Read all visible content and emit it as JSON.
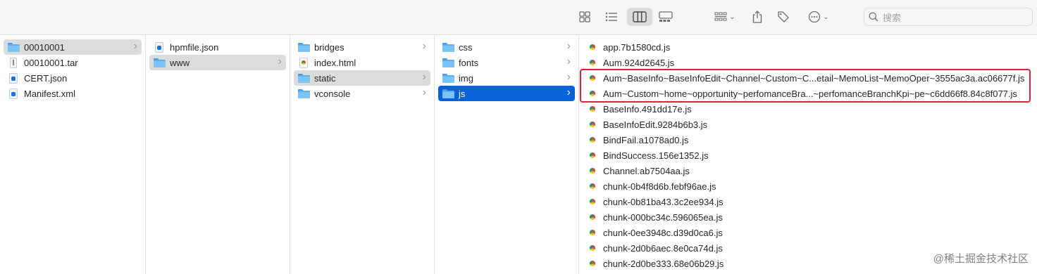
{
  "toolbar": {
    "icons": [
      "grid-view-icon",
      "list-view-icon",
      "column-view-icon",
      "gallery-view-icon",
      "group-icon",
      "share-icon",
      "tag-icon",
      "more-icon"
    ],
    "active_view": "column",
    "search_placeholder": "搜索"
  },
  "columns": [
    {
      "items": [
        {
          "name": "00010001",
          "kind": "folder",
          "state": "selected-gray",
          "has_children": true
        },
        {
          "name": "00010001.tar",
          "kind": "plain-file"
        },
        {
          "name": "CERT.json",
          "kind": "json-file"
        },
        {
          "name": "Manifest.xml",
          "kind": "xml-file"
        }
      ]
    },
    {
      "items": [
        {
          "name": "hpmfile.json",
          "kind": "json-file"
        },
        {
          "name": "www",
          "kind": "folder",
          "state": "selected-gray",
          "has_children": true
        }
      ]
    },
    {
      "items": [
        {
          "name": "bridges",
          "kind": "folder",
          "has_children": true
        },
        {
          "name": "index.html",
          "kind": "html-file"
        },
        {
          "name": "static",
          "kind": "folder",
          "state": "selected-gray",
          "has_children": true
        },
        {
          "name": "vconsole",
          "kind": "folder",
          "has_children": true
        }
      ]
    },
    {
      "items": [
        {
          "name": "css",
          "kind": "folder",
          "has_children": true
        },
        {
          "name": "fonts",
          "kind": "folder",
          "has_children": true
        },
        {
          "name": "img",
          "kind": "folder",
          "has_children": true
        },
        {
          "name": "js",
          "kind": "folder",
          "state": "selected-blue",
          "has_children": true
        }
      ]
    },
    {
      "items": [
        {
          "name": "app.7b1580cd.js",
          "kind": "js-file"
        },
        {
          "name": "Aum.924d2645.js",
          "kind": "js-file"
        },
        {
          "name": "Aum~BaseInfo~BaseInfoEdit~Channel~Custom~C...etail~MemoList~MemoOper~3555ac3a.ac06677f.js",
          "kind": "js-file",
          "highlighted": true
        },
        {
          "name": "Aum~Custom~home~opportunity~perfomanceBra...~perfomanceBranchKpi~pe~c6dd66f8.84c8f077.js",
          "kind": "js-file",
          "highlighted": true
        },
        {
          "name": "BaseInfo.491dd17e.js",
          "kind": "js-file"
        },
        {
          "name": "BaseInfoEdit.9284b6b3.js",
          "kind": "js-file"
        },
        {
          "name": "BindFail.a1078ad0.js",
          "kind": "js-file"
        },
        {
          "name": "BindSuccess.156e1352.js",
          "kind": "js-file"
        },
        {
          "name": "Channel.ab7504aa.js",
          "kind": "js-file"
        },
        {
          "name": "chunk-0b4f8d6b.febf96ae.js",
          "kind": "js-file"
        },
        {
          "name": "chunk-0b81ba43.3c2ee934.js",
          "kind": "js-file"
        },
        {
          "name": "chunk-000bc34c.596065ea.js",
          "kind": "js-file"
        },
        {
          "name": "chunk-0ee3948c.d39d0ca6.js",
          "kind": "js-file"
        },
        {
          "name": "chunk-2d0b6aec.8e0ca74d.js",
          "kind": "js-file"
        },
        {
          "name": "chunk-2d0be333.68e06b29.js",
          "kind": "js-file"
        }
      ]
    }
  ],
  "highlight_color": "#e0213a",
  "selection_color": "#0a62d9",
  "watermark": "@稀土掘金技术社区"
}
